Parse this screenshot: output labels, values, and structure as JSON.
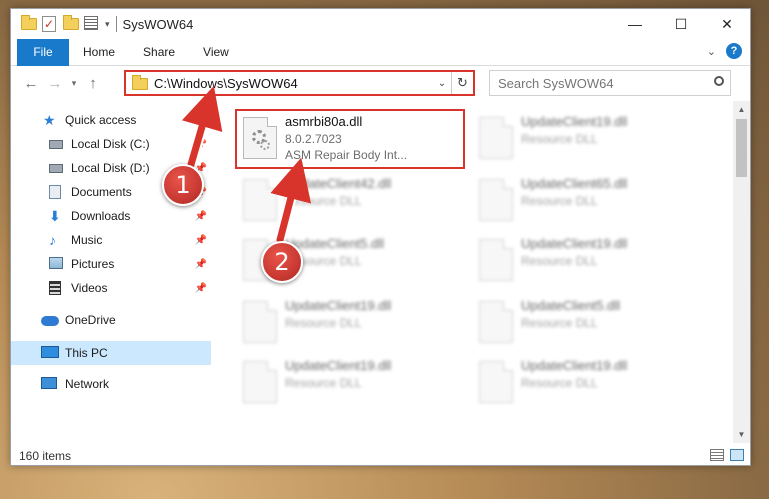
{
  "window": {
    "title": "SysWOW64",
    "controls": {
      "minimize": "—",
      "maximize": "☐",
      "close": "✕"
    }
  },
  "ribbon": {
    "tabs": [
      "File",
      "Home",
      "Share",
      "View"
    ],
    "expand_icon": "chevron-down-icon",
    "help_label": "?"
  },
  "navigation": {
    "back": "←",
    "forward": "→",
    "recent": "▾",
    "up": "↑",
    "address": "C:\\Windows\\SysWOW64",
    "address_dropdown": "⌄",
    "refresh": "↻",
    "search_placeholder": "Search SysWOW64"
  },
  "sidebar": {
    "items": [
      {
        "label": "Quick access",
        "icon": "star-icon",
        "pinned": false
      },
      {
        "label": "Local Disk (C:)",
        "icon": "drive-icon",
        "pinned": true
      },
      {
        "label": "Local Disk (D:)",
        "icon": "drive-icon",
        "pinned": true
      },
      {
        "label": "Documents",
        "icon": "documents-icon",
        "pinned": true
      },
      {
        "label": "Downloads",
        "icon": "downloads-icon",
        "pinned": true
      },
      {
        "label": "Music",
        "icon": "music-icon",
        "pinned": true
      },
      {
        "label": "Pictures",
        "icon": "pictures-icon",
        "pinned": true
      },
      {
        "label": "Videos",
        "icon": "videos-icon",
        "pinned": true
      },
      {
        "label": "OneDrive",
        "icon": "onedrive-icon",
        "pinned": false
      },
      {
        "label": "This PC",
        "icon": "this-pc-icon",
        "pinned": false,
        "selected": true
      },
      {
        "label": "Network",
        "icon": "network-icon",
        "pinned": false
      }
    ]
  },
  "files": {
    "highlighted": {
      "name": "asmrbi80a.dll",
      "version": "8.0.2.7023",
      "description": "ASM Repair Body Int..."
    },
    "blurred": [
      {
        "name": "UpdateClient19.dll",
        "type": "Resource DLL"
      },
      {
        "name": "UpdateClient42.dll",
        "type": "Resource DLL"
      },
      {
        "name": "UpdateClient65.dll",
        "type": "Resource DLL"
      },
      {
        "name": "UpdateClient5.dll",
        "type": "Resource DLL"
      },
      {
        "name": "UpdateClient19.dll",
        "type": "Resource DLL"
      },
      {
        "name": "UpdateClient19.dll",
        "type": "Resource DLL"
      },
      {
        "name": "UpdateClient5.dll",
        "type": "Resource DLL"
      },
      {
        "name": "UpdateClient19.dll",
        "type": "Resource DLL"
      },
      {
        "name": "UpdateClient19.dll",
        "type": "Resource DLL"
      }
    ]
  },
  "status": {
    "item_count": "160 items"
  },
  "annotations": {
    "step1": "1",
    "step2": "2",
    "color": "#d9342b"
  }
}
